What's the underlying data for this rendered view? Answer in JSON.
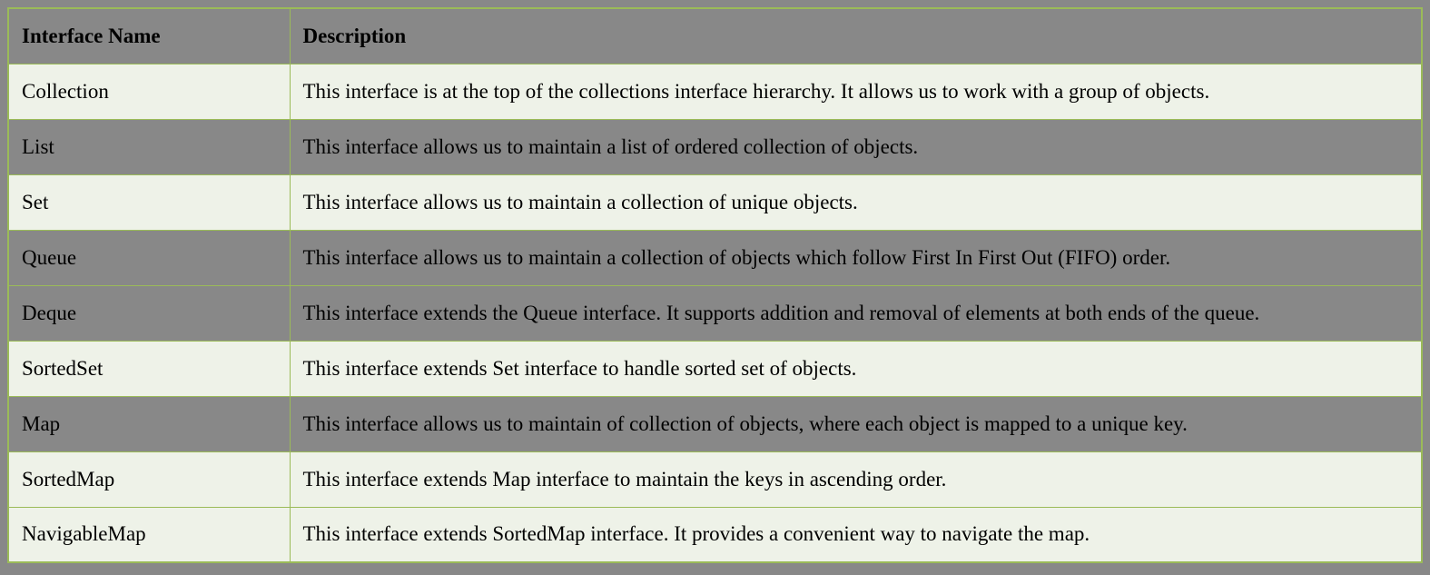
{
  "headers": [
    "Interface Name",
    "Description"
  ],
  "rows": [
    {
      "name": "Collection",
      "desc": "This interface is at the top of the collections interface hierarchy. It allows us to work with a group of objects.",
      "shade": "light"
    },
    {
      "name": "List",
      "desc": "This interface allows us to maintain a list of ordered collection of objects.",
      "shade": "dark"
    },
    {
      "name": "Set",
      "desc": "This interface allows us to maintain a collection of unique objects.",
      "shade": "light"
    },
    {
      "name": "Queue",
      "desc": "This interface allows us to maintain a collection of objects which follow First In First Out (FIFO) order.",
      "shade": "dark"
    },
    {
      "name": "Deque",
      "desc": "This interface extends the Queue interface. It supports addition and removal of elements at both ends of the queue.",
      "shade": "dark"
    },
    {
      "name": "SortedSet",
      "desc": "This interface extends Set interface to handle sorted set of objects.",
      "shade": "light"
    },
    {
      "name": "Map",
      "desc": "This interface allows us to maintain of collection of objects, where each object is mapped to a unique key.",
      "shade": "dark"
    },
    {
      "name": "SortedMap",
      "desc": "This interface extends Map interface to maintain the keys in ascending order.",
      "shade": "light"
    },
    {
      "name": "NavigableMap",
      "desc": "This interface extends SortedMap interface. It provides a convenient way to navigate the map.",
      "shade": "light"
    }
  ]
}
